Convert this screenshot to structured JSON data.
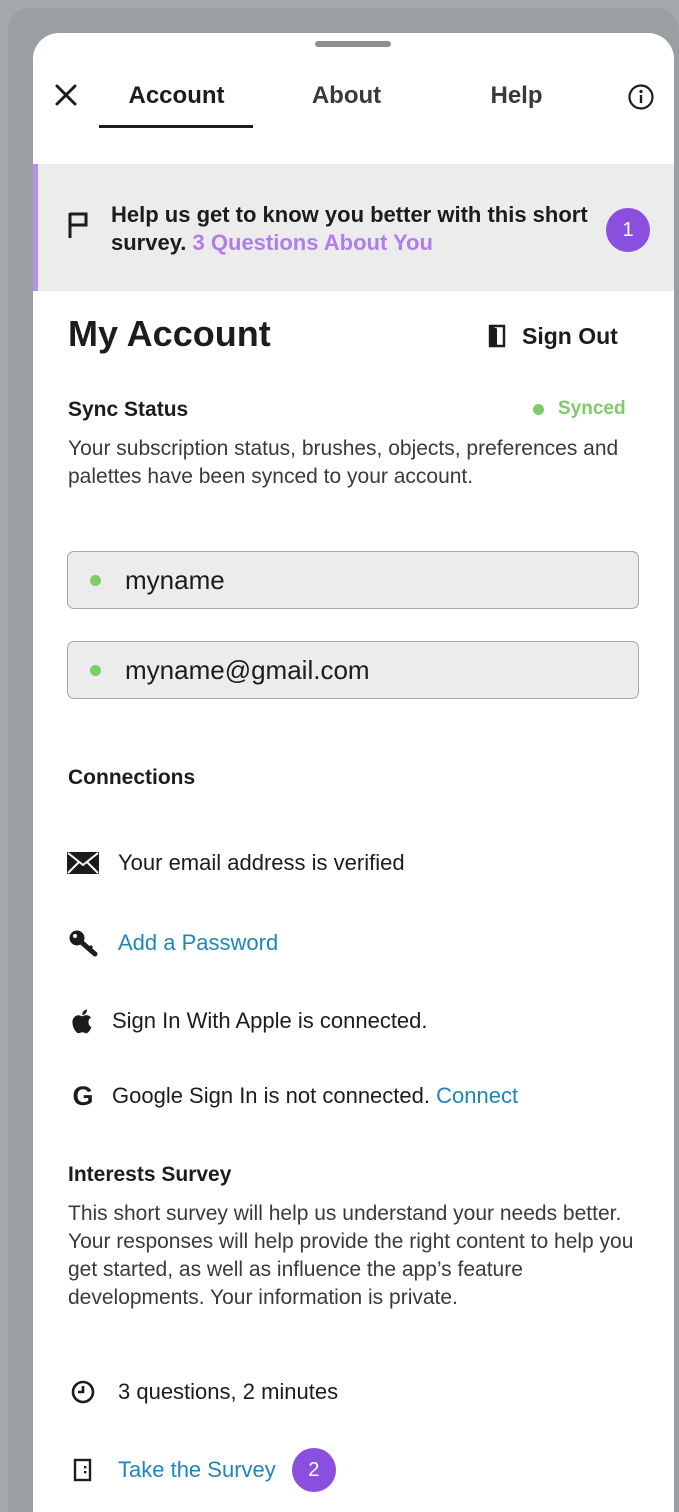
{
  "tabs": {
    "account": "Account",
    "about": "About",
    "help": "Help"
  },
  "banner": {
    "text": "Help us get to know you better with this short survey.",
    "link": "3 Questions About You",
    "badge": "1",
    "accent_color": "#b594e6"
  },
  "account": {
    "title": "My Account",
    "sign_out": "Sign Out"
  },
  "sync": {
    "title": "Sync Status",
    "status": "Synced",
    "status_color": "#7ccc6b",
    "description": "Your subscription status, brushes, objects, preferences and palettes have been synced to your account."
  },
  "fields": {
    "username": "myname",
    "email": "myname@gmail.com"
  },
  "connections": {
    "title": "Connections",
    "email_verified": "Your email address is verified",
    "add_password": "Add a Password",
    "apple": "Sign In With Apple is connected.",
    "google": "Google Sign In is not connected.",
    "google_connect": "Connect",
    "link_color": "#1f86b8"
  },
  "survey": {
    "title": "Interests Survey",
    "description": "This short survey will help us understand your needs better. Your responses will help provide the right content to help you get started, as well as influence the app’s feature developments. Your information is private.",
    "duration": "3 questions, 2 minutes",
    "take": "Take the Survey",
    "badge": "2"
  },
  "icons": [
    "close-icon",
    "info-icon",
    "flag-icon",
    "sign-out-door-icon",
    "envelope-icon",
    "key-icon",
    "apple-icon",
    "google-icon",
    "clock-icon",
    "survey-form-icon"
  ]
}
